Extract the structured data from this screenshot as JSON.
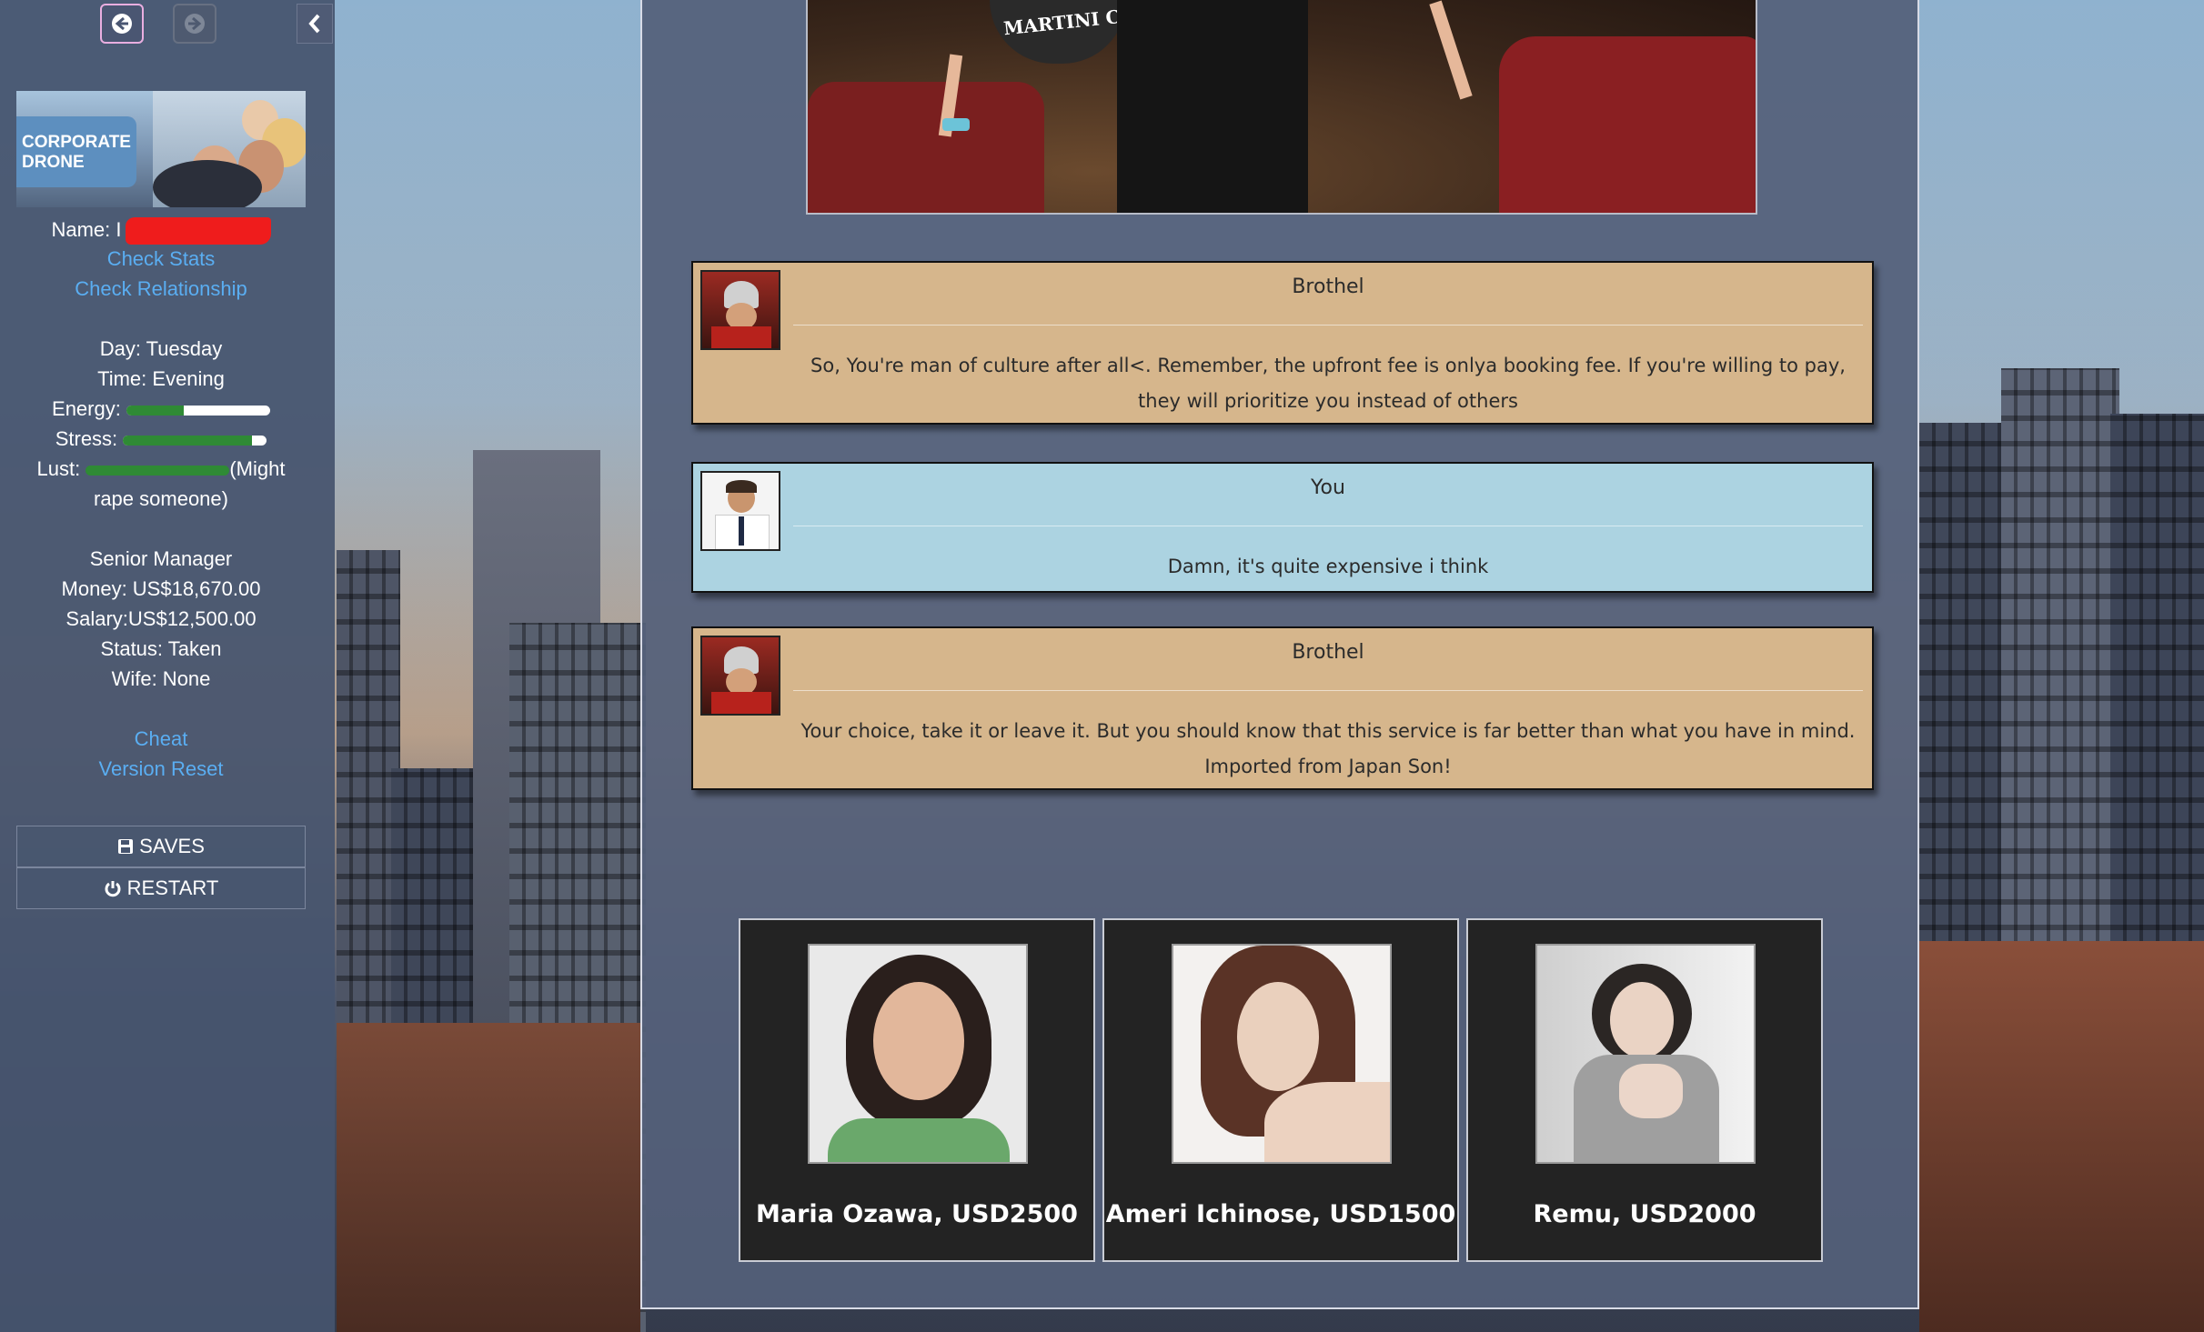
{
  "sidebar": {
    "banner_title": "CORPORATE DRONE",
    "name_label": "Name:",
    "name_prefix": "I",
    "links": {
      "check_stats": "Check Stats",
      "check_relationship": "Check Relationship"
    },
    "day": "Day: Tuesday",
    "time": "Time: Evening",
    "energy": {
      "label": "Energy:",
      "level": 0.4
    },
    "stress": {
      "label": "Stress:",
      "level": 0.9
    },
    "lust": {
      "label": "Lust:",
      "level": 1.0,
      "note": "(Might",
      "note2": "rape someone)"
    },
    "job": "Senior Manager",
    "money": "Money: US$18,670.00",
    "salary": "Salary:US$12,500.00",
    "status": "Status: Taken",
    "wife": "Wife: None",
    "cheat": "Cheat",
    "version_reset": "Version Reset",
    "saves": "SAVES",
    "restart": "RESTART",
    "icons": {
      "back": "arrow-left-icon",
      "forward": "arrow-right-icon",
      "collapse": "chevron-left-icon",
      "saves": "floppy-disk-icon",
      "restart": "power-icon"
    }
  },
  "scene": {
    "sign_text": "MARTINI CL"
  },
  "messages": [
    {
      "speaker": "Brothel",
      "text": "So, You're man of culture after all<. Remember, the upfront fee is onlya booking fee. If you're willing to pay, they will prioritize you instead of others"
    },
    {
      "speaker": "You",
      "text": "Damn, it's quite expensive i think"
    },
    {
      "speaker": "Brothel",
      "text": "Your choice, take it or leave it. But you should know that this service is far better than what you have in mind. Imported from Japan Son!"
    }
  ],
  "choices": [
    {
      "label": "Maria Ozawa, USD2500"
    },
    {
      "label": "Ameri Ichinose, USD1500"
    },
    {
      "label": "Remu, USD2000"
    }
  ],
  "colors": {
    "sidebar_bg": "#46546e",
    "link": "#5aaef2",
    "brothel_bubble": "#d6b68c",
    "you_bubble": "#acd3e1",
    "bar_fill": "#2f8a35",
    "card_bg": "#232323"
  }
}
